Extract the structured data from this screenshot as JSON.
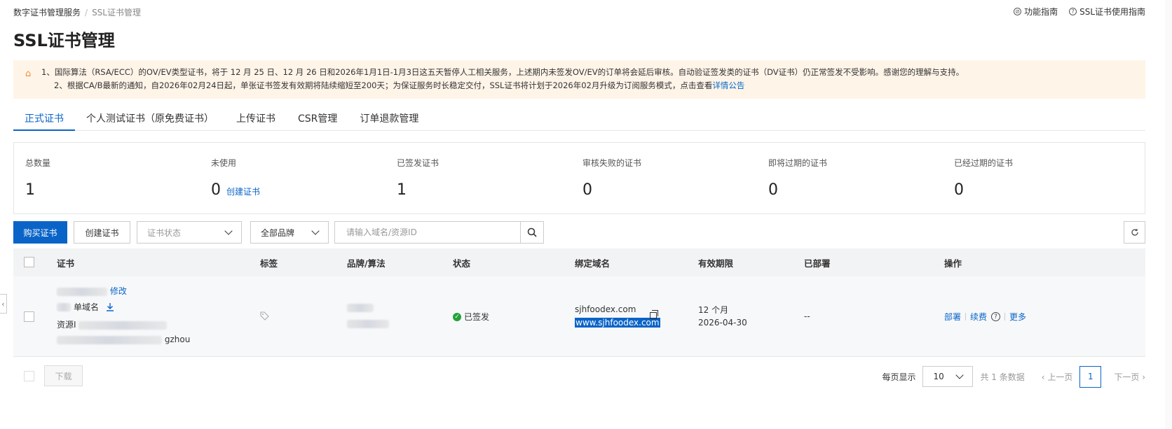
{
  "breadcrumb": {
    "parent": "数字证书管理服务",
    "separator": "/",
    "current": "SSL证书管理"
  },
  "top_links": [
    {
      "label": "功能指南"
    },
    {
      "label": "SSL证书使用指南"
    }
  ],
  "page_title": "SSL证书管理",
  "notice": {
    "line1": "1、国际算法（RSA/ECC）的OV/EV类型证书，将于 12 月 25 日、12 月 26 日和2026年1月1日-1月3日这五天暂停人工相关服务，上述期内未签发OV/EV的订单将会延后审核。自动验证签发类的证书（DV证书）仍正常签发不受影响。感谢您的理解与支持。",
    "line2": "2、根据CA/B最新的通知，自2026年02月24日起，单张证书签发有效期将陆续缩短至200天；为保证服务时长稳定交付，SSL证书将计划于2026年02月升级为订阅服务模式，点击查看",
    "line2_link": "详情公告"
  },
  "tabs": [
    {
      "label": "正式证书",
      "active": true
    },
    {
      "label": "个人测试证书（原免费证书）"
    },
    {
      "label": "上传证书"
    },
    {
      "label": "CSR管理"
    },
    {
      "label": "订单退款管理"
    }
  ],
  "stats": [
    {
      "label": "总数量",
      "value": "1"
    },
    {
      "label": "未使用",
      "value": "0",
      "link": "创建证书"
    },
    {
      "label": "已签发证书",
      "value": "1"
    },
    {
      "label": "审核失败的证书",
      "value": "0"
    },
    {
      "label": "即将过期的证书",
      "value": "0"
    },
    {
      "label": "已经过期的证书",
      "value": "0"
    }
  ],
  "toolbar": {
    "buy_label": "购买证书",
    "create_label": "创建证书",
    "status_placeholder": "证书状态",
    "brand_value": "全部品牌",
    "search_placeholder": "请输入域名/资源ID"
  },
  "table": {
    "headers": [
      "证书",
      "标签",
      "品牌/算法",
      "状态",
      "绑定域名",
      "有效期限",
      "已部署",
      "操作"
    ],
    "row": {
      "cert_edit": "修改",
      "cert_type_suffix": "单域名",
      "resource_label": "资源I",
      "org_suffix": "gzhou",
      "status": "已签发",
      "domain1": "sjhfoodex.com",
      "domain2": "www.sjhfoodex.com",
      "validity": "12 个月",
      "expiry": "2026-04-30",
      "deployed": "--",
      "ops": [
        "部署",
        "续费",
        "更多"
      ]
    }
  },
  "footer": {
    "download_label": "下载",
    "per_page_label": "每页显示",
    "per_page_value": "10",
    "total_text": "共 1 条数据",
    "prev_label": "上一页",
    "page": "1",
    "next_label": "下一页"
  },
  "colors": {
    "primary": "#0a64c8",
    "notice_bg": "#fff4e8",
    "success": "#22a33a"
  }
}
